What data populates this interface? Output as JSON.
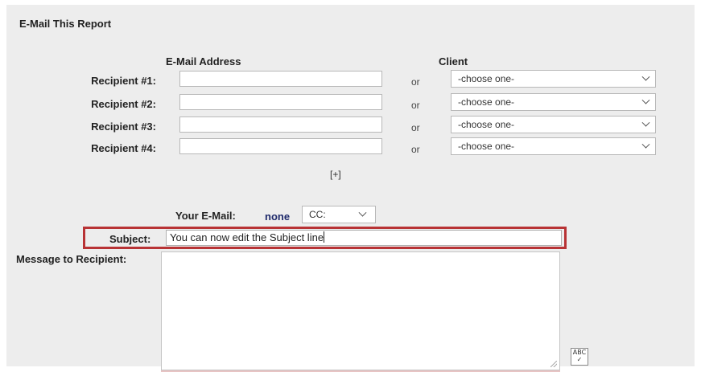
{
  "form": {
    "title": "E-Mail This Report",
    "col_email": "E-Mail Address",
    "col_client": "Client",
    "or_label": "or",
    "recipients": [
      {
        "label": "Recipient #1:",
        "email": "",
        "client": "-choose one-"
      },
      {
        "label": "Recipient #2:",
        "email": "",
        "client": "-choose one-"
      },
      {
        "label": "Recipient #3:",
        "email": "",
        "client": "-choose one-"
      },
      {
        "label": "Recipient #4:",
        "email": "",
        "client": "-choose one-"
      }
    ],
    "add_recipient": "[+]",
    "your_email_label": "Your E-Mail:",
    "your_email_value": "none",
    "cc_value": "CC:",
    "subject_label": "Subject:",
    "subject_value": "You can now edit the Subject line",
    "message_label": "Message to Recipient:",
    "message_value": "",
    "spellcheck_glyph": "ABC ✓"
  },
  "colors": {
    "panel_bg": "#ededed",
    "highlight_border": "#b83335",
    "none_text": "#1f2a6b"
  }
}
